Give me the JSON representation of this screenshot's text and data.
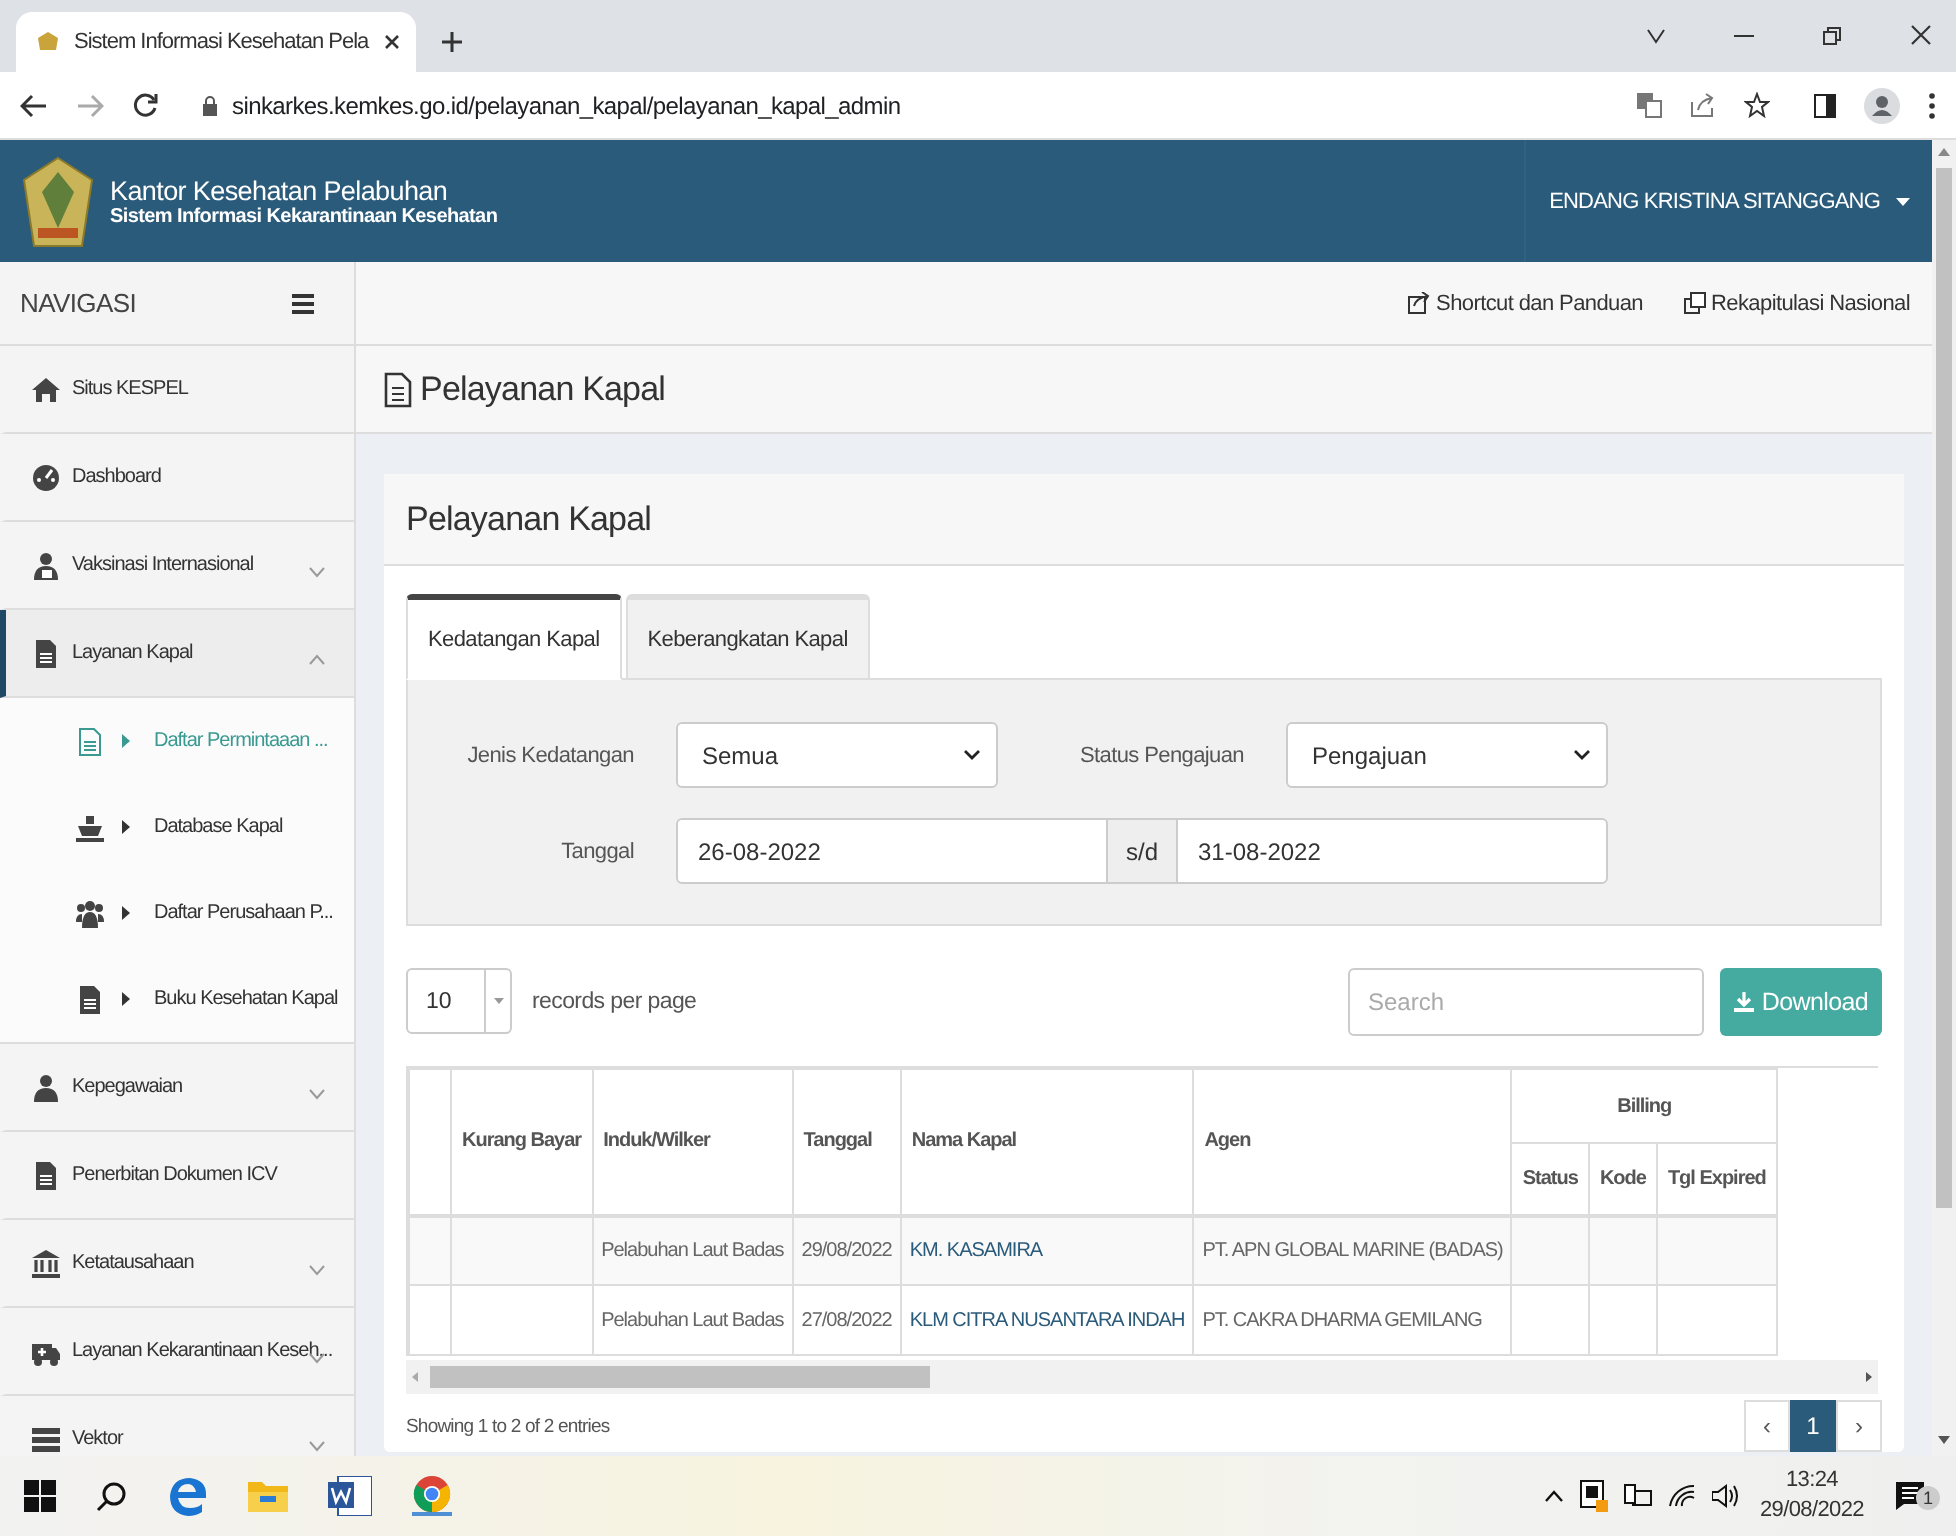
{
  "browser": {
    "tab_title": "Sistem Informasi Kesehatan Pela",
    "url": "sinkarkes.kemkes.go.id/pelayanan_kapal/pelayanan_kapal_admin"
  },
  "header": {
    "title": "Kantor Kesehatan Pelabuhan",
    "subtitle": "Sistem Informasi Kekarantinaan Kesehatan",
    "user": "ENDANG KRISTINA SITANGGANG"
  },
  "sidebar": {
    "title": "NAVIGASI",
    "items": [
      {
        "label": "Situs KESPEL",
        "selected": false
      },
      {
        "label": "Dashboard",
        "selected": false
      },
      {
        "label": "Vaksinasi Internasional",
        "selected": false,
        "expanded": false
      },
      {
        "label": "Layanan Kapal",
        "selected": true,
        "expanded": true,
        "children": [
          {
            "label": "Daftar Permintaaan ...",
            "selected": true
          },
          {
            "label": "Database Kapal",
            "selected": false
          },
          {
            "label": "Daftar Perusahaan P...",
            "selected": false
          },
          {
            "label": "Buku Kesehatan Kapal",
            "selected": false
          }
        ]
      },
      {
        "label": "Kepegawaian",
        "selected": false,
        "expanded": false
      },
      {
        "label": "Penerbitan Dokumen ICV",
        "selected": false
      },
      {
        "label": "Ketatausahaan",
        "selected": false,
        "expanded": false
      },
      {
        "label": "Layanan Kekarantinaan Keseh...",
        "selected": false,
        "expanded": false
      },
      {
        "label": "Vektor",
        "selected": false,
        "expanded": false
      }
    ]
  },
  "top_links": [
    "Shortcut dan Panduan",
    "Rekapitulasi Nasional"
  ],
  "page_title": "Pelayanan Kapal",
  "card": {
    "title": "Pelayanan Kapal",
    "tabs": [
      {
        "label": "Kedatangan Kapal",
        "selected": true
      },
      {
        "label": "Keberangkatan Kapal",
        "selected": false
      }
    ],
    "filters": {
      "jenis_label": "Jenis Kedatangan",
      "jenis_value": "Semua",
      "status_label": "Status Pengajuan",
      "status_value": "Pengajuan",
      "date_label": "Tanggal",
      "date_from": "26-08-2022",
      "date_sep": "s/d",
      "date_to": "31-08-2022"
    },
    "page_size": "10",
    "page_size_label": "records per page",
    "search": {
      "placeholder": "Search"
    },
    "download": "Download",
    "table": {
      "columns": [
        {
          "label": "Kurang Bayar",
          "kind": "text"
        },
        {
          "label": "Induk/Wilker",
          "kind": "text"
        },
        {
          "label": "Tanggal",
          "kind": "text"
        },
        {
          "label": "Nama Kapal",
          "kind": "link"
        },
        {
          "label": "Agen",
          "kind": "text"
        }
      ],
      "group": {
        "label": "Billing",
        "columns": [
          "Status",
          "Kode",
          "Tgl Expired"
        ]
      },
      "rows": [
        {
          "cells": [
            null,
            "Pelabuhan Laut Badas",
            "29/08/2022",
            "KM. KASAMIRA",
            "PT. APN GLOBAL MARINE (BADAS)",
            null,
            null,
            null
          ]
        },
        {
          "cells": [
            null,
            "Pelabuhan Laut Badas",
            "27/08/2022",
            "KLM CITRA NUSANTARA INDAH",
            "PT. CAKRA DHARMA GEMILANG",
            null,
            null,
            null
          ]
        }
      ]
    },
    "summary": "Showing 1 to 2 of 2 entries",
    "pagination": [
      {
        "label": "‹",
        "selected": false
      },
      {
        "label": "1",
        "selected": true
      },
      {
        "label": "›",
        "selected": false
      }
    ]
  },
  "taskbar": {
    "time": "13:24",
    "date": "29/08/2022",
    "notifications": "1"
  }
}
